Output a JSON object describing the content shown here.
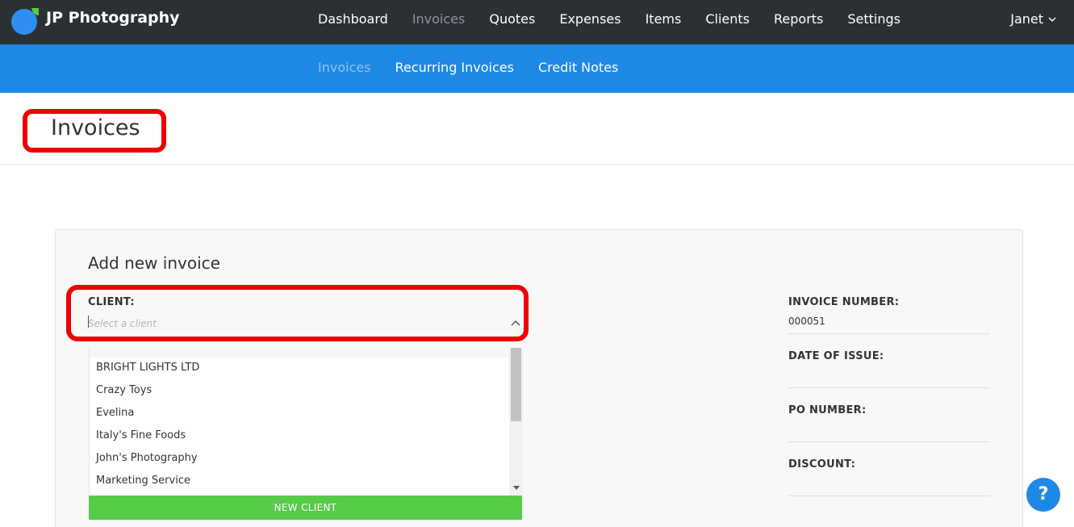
{
  "app": {
    "brand": "JP Photography"
  },
  "nav": {
    "items": [
      "Dashboard",
      "Invoices",
      "Quotes",
      "Expenses",
      "Items",
      "Clients",
      "Reports",
      "Settings"
    ],
    "active": "Invoices",
    "user": "Janet"
  },
  "subnav": {
    "items": [
      "Invoices",
      "Recurring Invoices",
      "Credit Notes"
    ],
    "active": "Invoices"
  },
  "page": {
    "title": "Invoices"
  },
  "form": {
    "title": "Add new invoice",
    "client_label": "CLIENT:",
    "client_placeholder": "Select a client",
    "clients": [
      "BRIGHT LIGHTS LTD",
      "Crazy Toys",
      "Evelina",
      "Italy's Fine Foods",
      "John's Photography",
      "Marketing Service"
    ],
    "new_client_label": "NEW CLIENT",
    "invoice_number_label": "INVOICE NUMBER:",
    "invoice_number_value": "000051",
    "date_label": "DATE OF ISSUE:",
    "po_label": "PO NUMBER:",
    "discount_label": "DISCOUNT:"
  },
  "help": {
    "label": "?"
  },
  "colors": {
    "topbar": "#2b3035",
    "subbar": "#1e88e5",
    "highlight": "#ee0000",
    "new_client": "#55cb48"
  },
  "icons": [
    "logo-icon",
    "chevron-down-icon",
    "chevron-up-icon",
    "help-icon"
  ]
}
